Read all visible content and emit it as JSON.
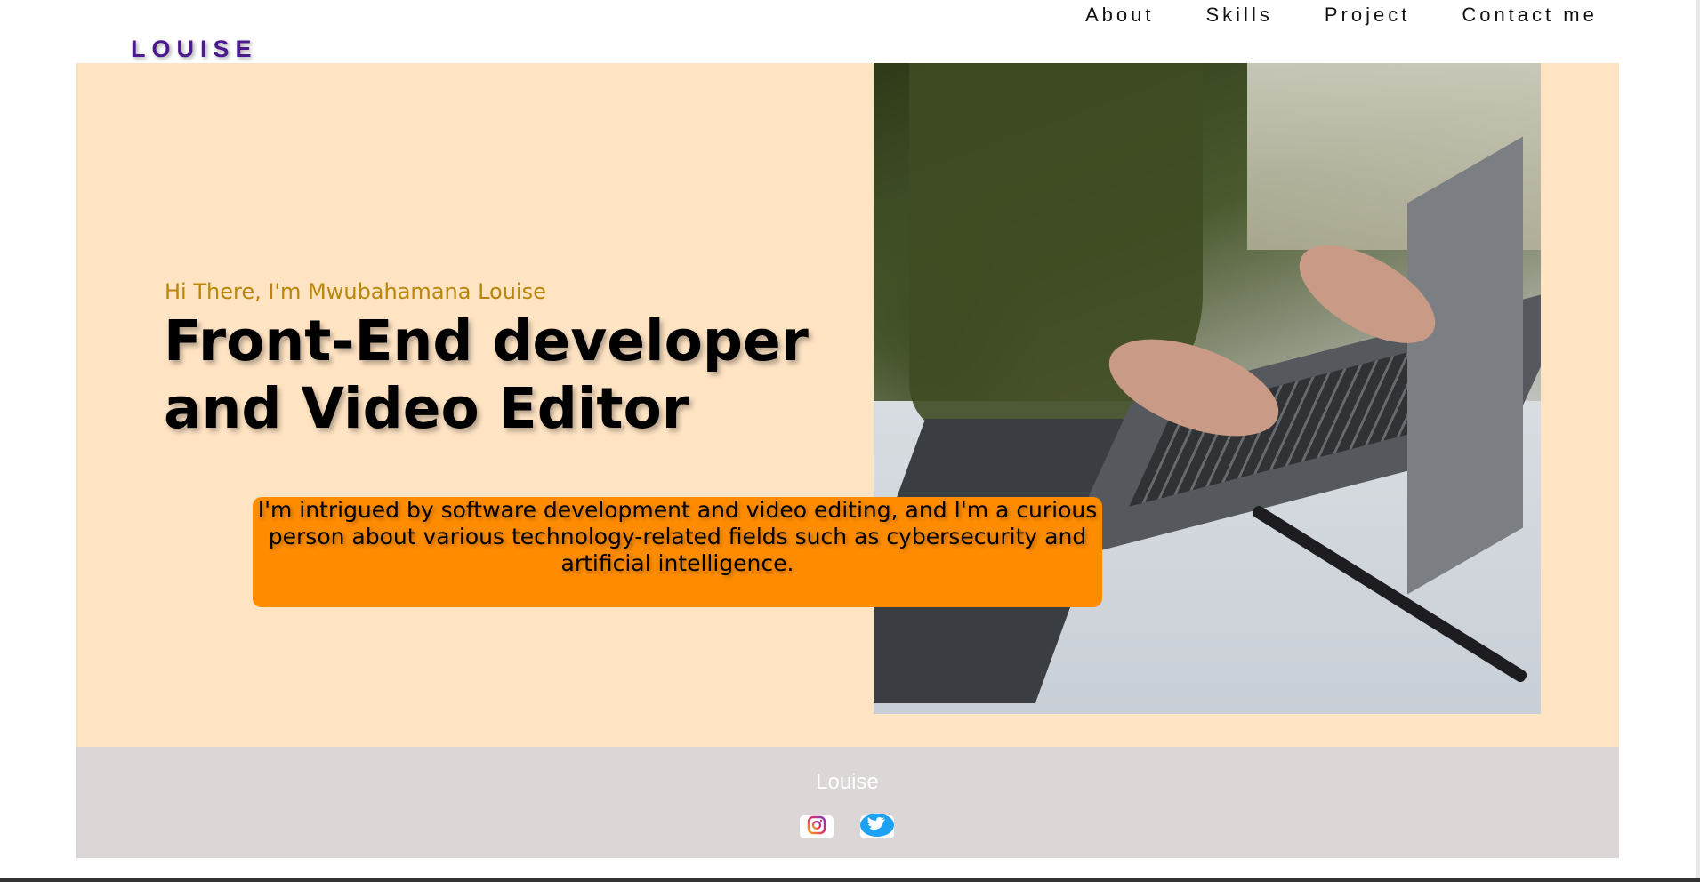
{
  "brand": {
    "logo_text": "LOUISE"
  },
  "nav": {
    "items": [
      {
        "label": "About"
      },
      {
        "label": "Skills"
      },
      {
        "label": "Project"
      },
      {
        "label": "Contact me"
      }
    ]
  },
  "hero": {
    "greeting": "Hi There, I'm Mwubahamana Louise",
    "title_line1": "Front-End developer",
    "title_line2": "and Video Editor",
    "intro": "I'm intrigued by software development and video editing, and I'm a curious person about various technology-related fields such as cybersecurity and artificial intelligence.",
    "image_icon": "laptop-typing-photo"
  },
  "footer": {
    "name": "Louise",
    "social_icons": [
      "instagram-icon",
      "twitter-icon"
    ]
  },
  "colors": {
    "hero_background": "#ffe4c4",
    "intro_box": "#ff8c00",
    "greeting_text": "#b8860b",
    "logo_text": "#4b1a8f",
    "footer_background": "#dcd6d7"
  }
}
